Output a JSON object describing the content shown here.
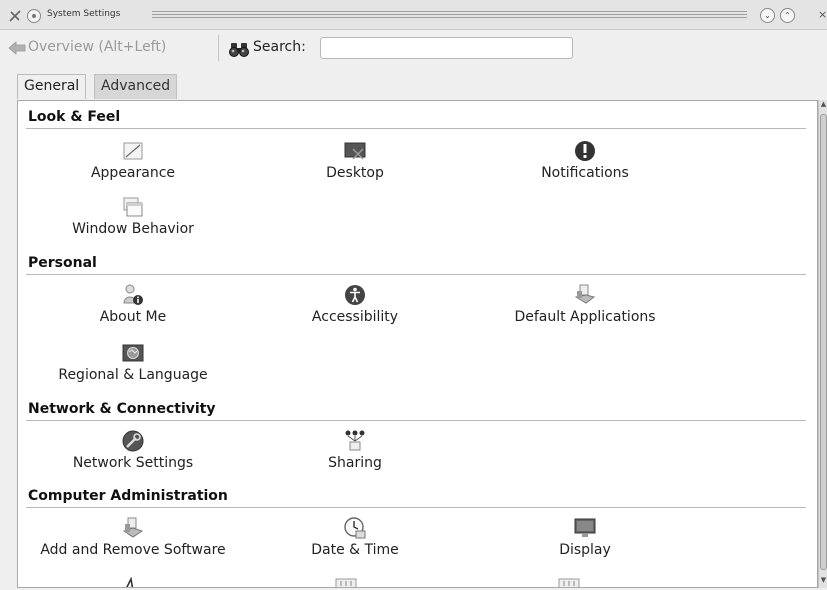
{
  "window": {
    "title": "System Settings",
    "shade_glyph": "⌄",
    "maximize_glyph": "⌃",
    "close_glyph": "×"
  },
  "toolbar": {
    "overview_label": "Overview (Alt+Left)",
    "search_label": "Search:",
    "search_value": "",
    "back_icon": "back-arrow-icon",
    "search_icon": "binoculars-icon"
  },
  "tabs": [
    {
      "label": "General",
      "active": true
    },
    {
      "label": "Advanced",
      "active": false
    }
  ],
  "sections": [
    {
      "title": "Look & Feel",
      "items": [
        {
          "label": "Appearance",
          "icon": "appearance-icon"
        },
        {
          "label": "Desktop",
          "icon": "desktop-icon"
        },
        {
          "label": "Notifications",
          "icon": "notifications-icon"
        },
        {
          "label": "Window Behavior",
          "icon": "window-behavior-icon"
        }
      ]
    },
    {
      "title": "Personal",
      "items": [
        {
          "label": "About Me",
          "icon": "about-me-icon"
        },
        {
          "label": "Accessibility",
          "icon": "accessibility-icon"
        },
        {
          "label": "Default Applications",
          "icon": "default-applications-icon"
        },
        {
          "label": "Regional & Language",
          "icon": "regional-language-icon"
        }
      ]
    },
    {
      "title": "Network & Connectivity",
      "items": [
        {
          "label": "Network Settings",
          "icon": "network-settings-icon"
        },
        {
          "label": "Sharing",
          "icon": "sharing-icon"
        }
      ]
    },
    {
      "title": "Computer Administration",
      "items": [
        {
          "label": "Add and Remove Software",
          "icon": "add-remove-software-icon"
        },
        {
          "label": "Date & Time",
          "icon": "date-time-icon"
        },
        {
          "label": "Display",
          "icon": "display-icon"
        }
      ]
    }
  ]
}
